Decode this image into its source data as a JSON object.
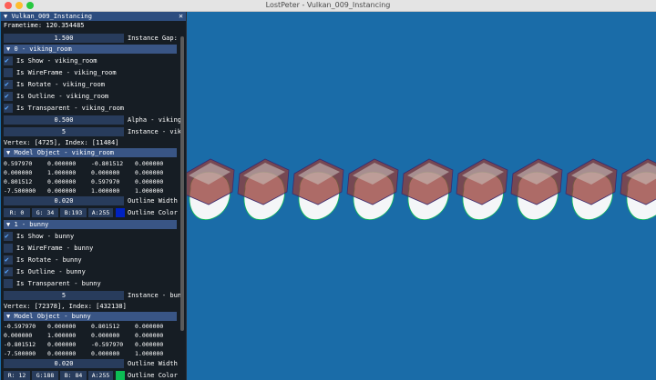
{
  "window": {
    "title": "LostPeter - Vulkan_009_Instancing"
  },
  "panel": {
    "title": "Vulkan_009_Instancing",
    "frametime": "Frametime: 120.354485",
    "instance_gap": {
      "value": "1.500",
      "label": "Instance Gap:"
    },
    "objects": [
      {
        "header": "0 - viking_room",
        "checkboxes": [
          {
            "label": "Is Show - viking_room",
            "checked": true
          },
          {
            "label": "Is WireFrame - viking_room",
            "checked": false
          },
          {
            "label": "Is Rotate - viking_room",
            "checked": true
          },
          {
            "label": "Is Outline - viking_room",
            "checked": true
          },
          {
            "label": "Is Transparent - viking_room",
            "checked": true
          }
        ],
        "alpha": {
          "value": "0.500",
          "label": "Alpha - viking"
        },
        "instance": {
          "value": "5",
          "label": "Instance - vik"
        },
        "vertex_index": "Vertex: [4725], Index: [11484]",
        "model_header": "Model Object - viking_room",
        "matrix": [
          [
            "0.597970",
            "0.000000",
            "-0.801512",
            "0.000000"
          ],
          [
            "0.000000",
            "1.000000",
            "0.000000",
            "0.000000"
          ],
          [
            "0.801512",
            "0.000000",
            "0.597970",
            "0.000000"
          ],
          [
            "-7.500000",
            "0.000000",
            "1.000000",
            "1.000000"
          ]
        ],
        "outline_width": {
          "value": "0.020",
          "label": "Outline Width"
        },
        "outline_color": {
          "r": "R:  0",
          "g": "G: 34",
          "b": "B:193",
          "a": "A:255",
          "label": "Outline Color",
          "swatch": "#0022c1"
        }
      },
      {
        "header": "1 - bunny",
        "checkboxes": [
          {
            "label": "Is Show - bunny",
            "checked": true
          },
          {
            "label": "Is WireFrame - bunny",
            "checked": false
          },
          {
            "label": "Is Rotate - bunny",
            "checked": true
          },
          {
            "label": "Is Outline - bunny",
            "checked": true
          },
          {
            "label": "Is Transparent - bunny",
            "checked": false
          }
        ],
        "instance": {
          "value": "5",
          "label": "Instance - bun"
        },
        "vertex_index": "Vertex: [72378], Index: [432138]",
        "model_header": "Model Object - bunny",
        "matrix": [
          [
            "-0.597970",
            "0.000000",
            "0.801512",
            "0.000000"
          ],
          [
            "0.000000",
            "1.000000",
            "0.000000",
            "0.000000"
          ],
          [
            "-0.801512",
            "0.000000",
            "-0.597970",
            "0.000000"
          ],
          [
            "-7.500000",
            "0.000000",
            "0.000000",
            "1.000000"
          ]
        ],
        "outline_width": {
          "value": "0.020",
          "label": "Outline Width"
        },
        "outline_color": {
          "r": "R: 12",
          "g": "G:188",
          "b": "B: 84",
          "a": "A:255",
          "label": "Outline Color",
          "swatch": "#0cbc54"
        }
      }
    ]
  }
}
